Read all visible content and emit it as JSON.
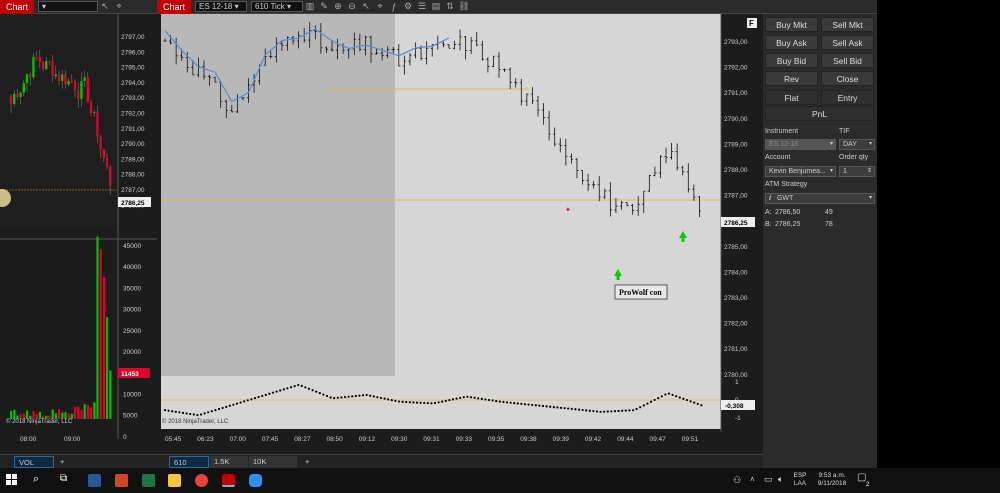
{
  "left_window": {
    "tab_label": "Chart",
    "instrument": "",
    "price_ticks": [
      "2797,00",
      "2796,00",
      "2795,00",
      "2794,00",
      "2793,00",
      "2792,00",
      "2791,00",
      "2790,00",
      "2789,00",
      "2788,00",
      "2787,00",
      "2786,00"
    ],
    "current_price": "2786,25",
    "volume_ticks": [
      "45000",
      "40000",
      "35000",
      "30000",
      "25000",
      "20000",
      "15000",
      "10000",
      "5000",
      "0"
    ],
    "current_volume": "11453",
    "time_ticks": [
      "08:00",
      "09:00"
    ],
    "copyright": "© 2018 NinjaTrader, LLC",
    "bottom_tab": "VOL",
    "add_tab": "+"
  },
  "main_window": {
    "tab_label": "Chart",
    "instrument": "ES 12-18",
    "interval": "610 Tick",
    "price_ticks": [
      "2793,00",
      "2792,00",
      "2791,00",
      "2790,00",
      "2789,00",
      "2788,00",
      "2787,00",
      "2786,00",
      "2785,00",
      "2784,00",
      "2783,00",
      "2782,00",
      "2781,00",
      "2780,00"
    ],
    "current_price": "2786,25",
    "indicator_ticks": [
      "1",
      "0",
      "-1"
    ],
    "indicator_value": "-0,308",
    "time_ticks": [
      "05:45",
      "06:23",
      "07:00",
      "07:45",
      "08:27",
      "08:50",
      "09:12",
      "09:30",
      "09:31",
      "09:33",
      "09:35",
      "09:38",
      "09:39",
      "09:42",
      "09:44",
      "09:47",
      "09:51"
    ],
    "annotation": "ProWolf con",
    "copyright": "© 2018 NinjaTrader, LLC",
    "corner_button": "F",
    "bottom_tabs": [
      "610",
      "1.5K",
      "10K"
    ],
    "add_tab": "+"
  },
  "chart_data": {
    "type": "candlestick",
    "instrument": "ES 12-18",
    "interval": "610 Tick",
    "x": [
      "05:45",
      "06:23",
      "07:00",
      "07:45",
      "08:27",
      "08:50",
      "09:12",
      "09:30",
      "09:31",
      "09:33",
      "09:35",
      "09:38",
      "09:39",
      "09:42",
      "09:44",
      "09:47",
      "09:51"
    ],
    "close": [
      2792.8,
      2791.6,
      2790.1,
      2792.0,
      2793.3,
      2792.3,
      2792.6,
      2792.0,
      2792.4,
      2792.7,
      2791.8,
      2790.2,
      2788.6,
      2786.9,
      2786.0,
      2788.6,
      2786.6
    ],
    "ylim": [
      2780,
      2793.8
    ],
    "current_price": 2786.25,
    "indicator": {
      "values": [
        -0.6,
        -0.9,
        -0.3,
        0.3,
        0.9,
        0.1,
        0.3,
        -0.1,
        -0.2,
        0.2,
        -0.1,
        -0.3,
        -0.5,
        -0.7,
        -0.6,
        0.4,
        -0.308
      ],
      "ylim": [
        -1.3,
        1.3
      ],
      "last": -0.308
    }
  },
  "right_panel": {
    "buttons": [
      "Buy Mkt",
      "Sell Mkt",
      "Buy Ask",
      "Sell Ask",
      "Buy Bid",
      "Sell Bid",
      "Rev",
      "Close"
    ],
    "flat": "Flat",
    "entry": "Entry",
    "pnl": "PnL",
    "instrument_label": "Instrument",
    "tif_label": "TIF",
    "instrument_value": "ES 12-18",
    "tif_value": "DAY",
    "account_label": "Account",
    "order_qty_label": "Order qty",
    "account_value": "Kevin Benjumea...",
    "order_qty_value": "1",
    "atm_label": "ATM Strategy",
    "atm_value": "GWT",
    "ask_label": "A:",
    "ask_price": "2786,50",
    "ask_size": "49",
    "bid_label": "B:",
    "bid_price": "2786,25",
    "bid_size": "78"
  },
  "taskbar": {
    "language": "ESP",
    "region": "LAA",
    "time": "9:53 a.m.",
    "date": "9/11/2018",
    "notification_count": "2"
  },
  "colors": {
    "up": "#00c000",
    "down": "#e0002a",
    "accent": "#c00000",
    "grid_gold": "#d4a020"
  }
}
